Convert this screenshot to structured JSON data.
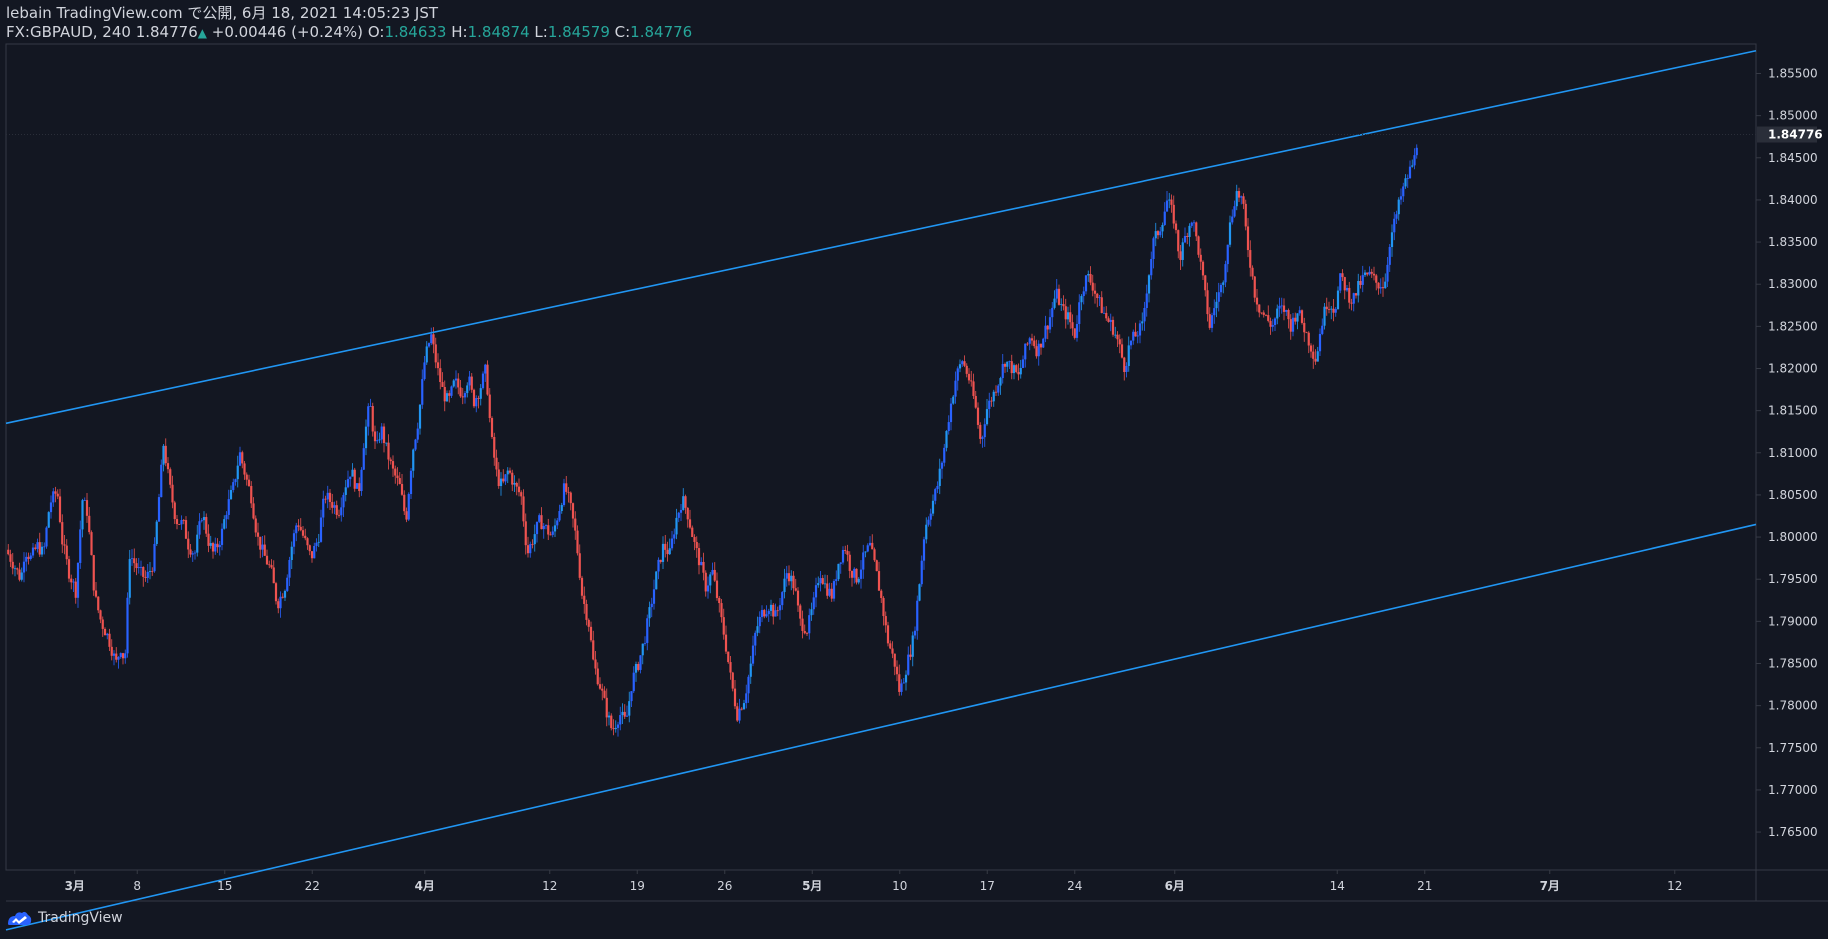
{
  "header": {
    "publish_line": "lebain TradingView.com で公開, 6月 18, 2021 14:05:23 JST",
    "symbol": "FX:GBPAUD, 240",
    "last_price": "1.84776",
    "change": "+0.00446 (+0.24%)",
    "open_label": "O:",
    "open_value": "1.84633",
    "high_label": "H:",
    "high_value": "1.84874",
    "low_label": "L:",
    "low_value": "1.84579",
    "close_label": "C:",
    "close_value": "1.84776"
  },
  "footer": {
    "brand": "TradingView"
  },
  "colors": {
    "background": "#131722",
    "up": "#2962ff",
    "up_alt": "#2196f3",
    "down": "#ef5350",
    "trendline": "#2196f3",
    "accent": "#26a69a",
    "axis_text": "#d1d4dc"
  },
  "chart_data": {
    "type": "candlestick",
    "symbol": "FX:GBPAUD",
    "interval": "240",
    "ylim": [
      1.7605,
      1.8585
    ],
    "y_ticks": [
      "1.76500",
      "1.77000",
      "1.77500",
      "1.78000",
      "1.78500",
      "1.79000",
      "1.79500",
      "1.80000",
      "1.80500",
      "1.81000",
      "1.81500",
      "1.82000",
      "1.82500",
      "1.83000",
      "1.83500",
      "1.84000",
      "1.84500",
      "1.85000",
      "1.85500"
    ],
    "x_ticks": [
      {
        "label": "3月",
        "day": 5,
        "bold": true
      },
      {
        "label": "8",
        "day": 10
      },
      {
        "label": "15",
        "day": 17
      },
      {
        "label": "22",
        "day": 24
      },
      {
        "label": "4月",
        "day": 33,
        "bold": true
      },
      {
        "label": "12",
        "day": 43
      },
      {
        "label": "19",
        "day": 50
      },
      {
        "label": "26",
        "day": 57
      },
      {
        "label": "5月",
        "day": 64,
        "bold": true
      },
      {
        "label": "10",
        "day": 71
      },
      {
        "label": "17",
        "day": 78
      },
      {
        "label": "24",
        "day": 85
      },
      {
        "label": "6月",
        "day": 93,
        "bold": true
      },
      {
        "label": "14",
        "day": 106
      },
      {
        "label": "21",
        "day": 113
      },
      {
        "label": "7月",
        "day": 123,
        "bold": true
      },
      {
        "label": "12",
        "day": 133
      }
    ],
    "last_price_label": "1.84776",
    "last_price": 1.84776,
    "close_path": [
      [
        -0.5,
        1.7985
      ],
      [
        0.2,
        1.7965
      ],
      [
        0.7,
        1.795
      ],
      [
        1.0,
        1.7985
      ],
      [
        1.5,
        1.7975
      ],
      [
        2.0,
        1.799
      ],
      [
        2.5,
        1.798
      ],
      [
        3.0,
        1.804
      ],
      [
        3.6,
        1.8055
      ],
      [
        4.0,
        1.7995
      ],
      [
        4.5,
        1.796
      ],
      [
        5.1,
        1.7935
      ],
      [
        5.6,
        1.8045
      ],
      [
        6.0,
        1.803
      ],
      [
        6.6,
        1.793
      ],
      [
        7.1,
        1.79
      ],
      [
        7.7,
        1.788
      ],
      [
        8.3,
        1.785
      ],
      [
        8.7,
        1.787
      ],
      [
        9.0,
        1.785
      ],
      [
        9.4,
        1.798
      ],
      [
        10.1,
        1.796
      ],
      [
        10.7,
        1.795
      ],
      [
        11.3,
        1.797
      ],
      [
        12.1,
        1.811
      ],
      [
        12.6,
        1.806
      ],
      [
        13.1,
        1.802
      ],
      [
        13.7,
        1.8015
      ],
      [
        14.1,
        1.799
      ],
      [
        14.6,
        1.798
      ],
      [
        15.2,
        1.803
      ],
      [
        15.7,
        1.7995
      ],
      [
        16.1,
        1.798
      ],
      [
        16.7,
        1.8
      ],
      [
        17.1,
        1.803
      ],
      [
        17.7,
        1.806
      ],
      [
        18.2,
        1.81
      ],
      [
        18.7,
        1.807
      ],
      [
        19.1,
        1.805
      ],
      [
        19.6,
        1.8
      ],
      [
        20.1,
        1.798
      ],
      [
        20.7,
        1.796
      ],
      [
        21.2,
        1.792
      ],
      [
        21.8,
        1.794
      ],
      [
        22.3,
        1.7985
      ],
      [
        22.8,
        1.802
      ],
      [
        23.3,
        1.8
      ],
      [
        23.9,
        1.7975
      ],
      [
        24.5,
        1.8
      ],
      [
        25.0,
        1.805
      ],
      [
        25.6,
        1.804
      ],
      [
        26.1,
        1.803
      ],
      [
        26.6,
        1.806
      ],
      [
        27.1,
        1.808
      ],
      [
        27.7,
        1.805
      ],
      [
        28.1,
        1.811
      ],
      [
        28.6,
        1.816
      ],
      [
        29.1,
        1.81
      ],
      [
        29.5,
        1.813
      ],
      [
        30.0,
        1.81
      ],
      [
        30.4,
        1.808
      ],
      [
        31.0,
        1.806
      ],
      [
        31.5,
        1.802
      ],
      [
        32.0,
        1.81
      ],
      [
        32.5,
        1.814
      ],
      [
        33.0,
        1.821
      ],
      [
        33.5,
        1.824
      ],
      [
        34.0,
        1.82
      ],
      [
        34.5,
        1.817
      ],
      [
        34.9,
        1.816
      ],
      [
        35.4,
        1.8185
      ],
      [
        36.0,
        1.817
      ],
      [
        36.5,
        1.819
      ],
      [
        36.9,
        1.816
      ],
      [
        37.4,
        1.8175
      ],
      [
        37.9,
        1.82
      ],
      [
        38.3,
        1.812
      ],
      [
        38.8,
        1.807
      ],
      [
        39.2,
        1.806
      ],
      [
        39.7,
        1.808
      ],
      [
        40.2,
        1.806
      ],
      [
        40.7,
        1.805
      ],
      [
        41.2,
        1.798
      ],
      [
        41.7,
        1.8
      ],
      [
        42.2,
        1.802
      ],
      [
        42.7,
        1.801
      ],
      [
        43.2,
        1.8
      ],
      [
        43.7,
        1.803
      ],
      [
        44.2,
        1.806
      ],
      [
        44.6,
        1.804
      ],
      [
        45.1,
        1.8
      ],
      [
        45.6,
        1.793
      ],
      [
        46.1,
        1.79
      ],
      [
        46.5,
        1.785
      ],
      [
        47.1,
        1.782
      ],
      [
        47.6,
        1.779
      ],
      [
        48.0,
        1.777
      ],
      [
        48.6,
        1.779
      ],
      [
        49.1,
        1.778
      ],
      [
        49.6,
        1.783
      ],
      [
        50.1,
        1.785
      ],
      [
        50.6,
        1.788
      ],
      [
        51.1,
        1.792
      ],
      [
        51.6,
        1.796
      ],
      [
        52.1,
        1.799
      ],
      [
        52.6,
        1.798
      ],
      [
        53.1,
        1.802
      ],
      [
        53.6,
        1.8045
      ],
      [
        54.0,
        1.803
      ],
      [
        54.6,
        1.799
      ],
      [
        55.0,
        1.797
      ],
      [
        55.5,
        1.794
      ],
      [
        56.0,
        1.796
      ],
      [
        56.5,
        1.792
      ],
      [
        57.0,
        1.788
      ],
      [
        57.5,
        1.783
      ],
      [
        58.0,
        1.779
      ],
      [
        58.6,
        1.781
      ],
      [
        59.1,
        1.785
      ],
      [
        59.5,
        1.789
      ],
      [
        60.0,
        1.791
      ],
      [
        60.6,
        1.792
      ],
      [
        61.1,
        1.7905
      ],
      [
        61.6,
        1.7935
      ],
      [
        62.0,
        1.796
      ],
      [
        62.6,
        1.794
      ],
      [
        63.0,
        1.79
      ],
      [
        63.6,
        1.789
      ],
      [
        64.1,
        1.792
      ],
      [
        64.6,
        1.796
      ],
      [
        65.1,
        1.794
      ],
      [
        65.6,
        1.793
      ],
      [
        66.1,
        1.797
      ],
      [
        66.6,
        1.799
      ],
      [
        67.1,
        1.796
      ],
      [
        67.6,
        1.795
      ],
      [
        68.1,
        1.7975
      ],
      [
        68.6,
        1.799
      ],
      [
        69.1,
        1.796
      ],
      [
        69.6,
        1.792
      ],
      [
        70.0,
        1.788
      ],
      [
        70.6,
        1.785
      ],
      [
        71.0,
        1.7815
      ],
      [
        71.6,
        1.785
      ],
      [
        72.1,
        1.788
      ],
      [
        72.6,
        1.795
      ],
      [
        73.0,
        1.801
      ],
      [
        73.6,
        1.804
      ],
      [
        74.0,
        1.806
      ],
      [
        74.5,
        1.81
      ],
      [
        75.0,
        1.815
      ],
      [
        75.5,
        1.819
      ],
      [
        76.0,
        1.821
      ],
      [
        76.5,
        1.819
      ],
      [
        77.0,
        1.816
      ],
      [
        77.5,
        1.811
      ],
      [
        77.9,
        1.815
      ],
      [
        78.5,
        1.817
      ],
      [
        79.0,
        1.819
      ],
      [
        79.4,
        1.821
      ],
      [
        80.0,
        1.82
      ],
      [
        80.5,
        1.819
      ],
      [
        81.0,
        1.822
      ],
      [
        81.5,
        1.824
      ],
      [
        82.0,
        1.822
      ],
      [
        82.5,
        1.824
      ],
      [
        83.0,
        1.826
      ],
      [
        83.5,
        1.829
      ],
      [
        84.0,
        1.827
      ],
      [
        84.5,
        1.826
      ],
      [
        85.0,
        1.824
      ],
      [
        85.5,
        1.829
      ],
      [
        86.0,
        1.831
      ],
      [
        86.4,
        1.83
      ],
      [
        86.9,
        1.828
      ],
      [
        87.5,
        1.826
      ],
      [
        88.0,
        1.825
      ],
      [
        88.5,
        1.823
      ],
      [
        89.0,
        1.82
      ],
      [
        89.4,
        1.823
      ],
      [
        89.9,
        1.824
      ],
      [
        90.4,
        1.825
      ],
      [
        90.8,
        1.83
      ],
      [
        91.3,
        1.835
      ],
      [
        91.9,
        1.837
      ],
      [
        92.4,
        1.84
      ],
      [
        92.9,
        1.838
      ],
      [
        93.4,
        1.833
      ],
      [
        93.9,
        1.836
      ],
      [
        94.4,
        1.838
      ],
      [
        94.9,
        1.834
      ],
      [
        95.3,
        1.83
      ],
      [
        95.8,
        1.825
      ],
      [
        96.3,
        1.828
      ],
      [
        96.8,
        1.83
      ],
      [
        97.3,
        1.836
      ],
      [
        97.9,
        1.841
      ],
      [
        98.4,
        1.84
      ],
      [
        98.8,
        1.835
      ],
      [
        99.4,
        1.829
      ],
      [
        99.8,
        1.827
      ],
      [
        100.3,
        1.826
      ],
      [
        100.8,
        1.825
      ],
      [
        101.3,
        1.827
      ],
      [
        101.8,
        1.827
      ],
      [
        102.3,
        1.825
      ],
      [
        102.8,
        1.827
      ],
      [
        103.3,
        1.825
      ],
      [
        103.8,
        1.823
      ],
      [
        104.3,
        1.821
      ],
      [
        104.7,
        1.825
      ],
      [
        105.2,
        1.828
      ],
      [
        105.8,
        1.827
      ],
      [
        106.3,
        1.831
      ],
      [
        106.8,
        1.829
      ],
      [
        107.2,
        1.828
      ],
      [
        107.8,
        1.83
      ],
      [
        108.2,
        1.831
      ],
      [
        108.7,
        1.831
      ],
      [
        109.2,
        1.83
      ],
      [
        109.8,
        1.83
      ],
      [
        110.2,
        1.835
      ],
      [
        110.7,
        1.838
      ],
      [
        111.2,
        1.841
      ],
      [
        111.7,
        1.843
      ],
      [
        112.2,
        1.845
      ],
      [
        112.45,
        1.84776
      ]
    ],
    "channel": {
      "upper": [
        [
          -0.5,
          1.8135
        ],
        [
          139.5,
          1.8577
        ]
      ],
      "lower": [
        [
          -0.5,
          1.7534
        ],
        [
          139.5,
          1.8015
        ]
      ]
    }
  }
}
